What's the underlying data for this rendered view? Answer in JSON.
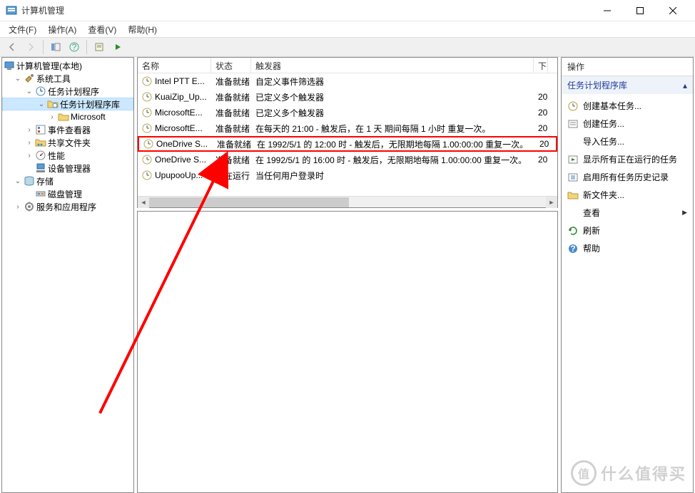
{
  "window": {
    "title": "计算机管理"
  },
  "menu": {
    "file": "文件(F)",
    "action": "操作(A)",
    "view": "查看(V)",
    "help": "帮助(H)"
  },
  "tree": {
    "root": "计算机管理(本地)",
    "system_tools": "系统工具",
    "task_scheduler": "任务计划程序",
    "task_scheduler_lib": "任务计划程序库",
    "microsoft": "Microsoft",
    "event_viewer": "事件查看器",
    "shared_folders": "共享文件夹",
    "performance": "性能",
    "device_manager": "设备管理器",
    "storage": "存储",
    "disk_management": "磁盘管理",
    "services_apps": "服务和应用程序"
  },
  "list": {
    "headers": {
      "name": "名称",
      "status": "状态",
      "trigger": "触发器",
      "next": "下"
    },
    "rows": [
      {
        "name": "Intel PTT E...",
        "status": "准备就绪",
        "trigger": "自定义事件筛选器",
        "next": ""
      },
      {
        "name": "KuaiZip_Up...",
        "status": "准备就绪",
        "trigger": "已定义多个触发器",
        "next": "20"
      },
      {
        "name": "MicrosoftE...",
        "status": "准备就绪",
        "trigger": "已定义多个触发器",
        "next": "20"
      },
      {
        "name": "MicrosoftE...",
        "status": "准备就绪",
        "trigger": "在每天的 21:00 - 触发后，在 1 天 期间每隔 1 小时 重复一次。",
        "next": "20"
      },
      {
        "name": "OneDrive S...",
        "status": "准备就绪",
        "trigger": "在 1992/5/1 的 12:00 时 - 触发后，无限期地每隔 1.00:00:00 重复一次。",
        "next": "20",
        "highlight": true
      },
      {
        "name": "OneDrive S...",
        "status": "准备就绪",
        "trigger": "在 1992/5/1 的 16:00 时 - 触发后，无限期地每隔 1.00:00:00 重复一次。",
        "next": "20"
      },
      {
        "name": "UpupooUp...",
        "status": "正在运行",
        "trigger": "当任何用户登录时",
        "next": ""
      }
    ]
  },
  "actions": {
    "header": "操作",
    "subheader": "任务计划程序库",
    "items": [
      {
        "icon": "task-new",
        "label": "创建基本任务..."
      },
      {
        "icon": "task-create",
        "label": "创建任务..."
      },
      {
        "icon": "import",
        "label": "导入任务..."
      },
      {
        "icon": "running",
        "label": "显示所有正在运行的任务"
      },
      {
        "icon": "history",
        "label": "启用所有任务历史记录"
      },
      {
        "icon": "folder",
        "label": "新文件夹..."
      },
      {
        "icon": "view",
        "label": "查看",
        "chevron": true
      },
      {
        "icon": "refresh",
        "label": "刷新"
      },
      {
        "icon": "help",
        "label": "帮助"
      }
    ]
  },
  "watermark": {
    "badge": "值",
    "text": "什么值得买"
  }
}
